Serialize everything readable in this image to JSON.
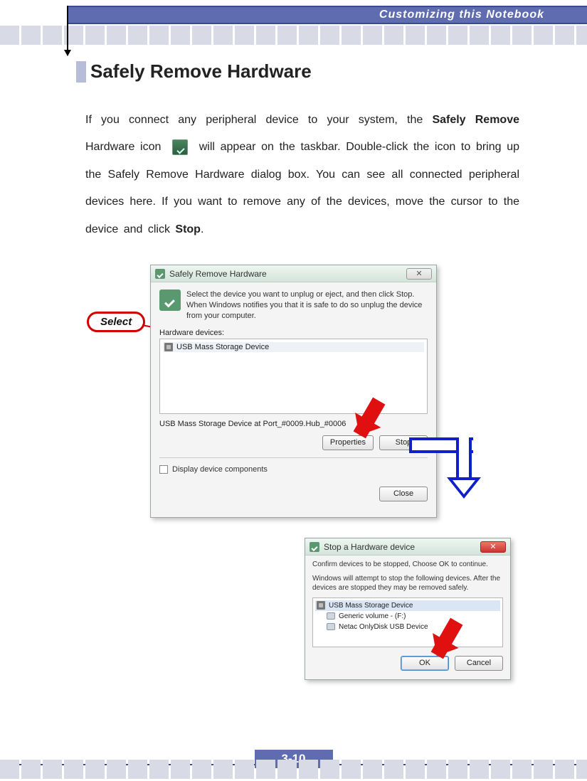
{
  "header": {
    "title": "Customizing this Notebook"
  },
  "section": {
    "title": "Safely Remove Hardware"
  },
  "paragraph": {
    "p1a": "If you connect any peripheral device to your system, the ",
    "p1b": "Safely Remove",
    "p1c": " Hardware icon ",
    "p1d": " will appear on the taskbar.  Double-click the icon to bring up the Safely Remove Hardware dialog box.  You can see all connected peripheral devices here.  If you want to remove any of the devices, move the cursor to the device and click ",
    "p1e": "Stop",
    "p1f": "."
  },
  "callout": {
    "select": "Select"
  },
  "dialog1": {
    "title": "Safely Remove Hardware",
    "instr": "Select the device you want to unplug or eject, and then click Stop. When Windows notifies you that it is safe to do so unplug the device from your computer.",
    "devices_label": "Hardware devices:",
    "device_item": "USB Mass Storage Device",
    "status": "USB Mass Storage Device at Port_#0009.Hub_#0006",
    "btn_properties": "Properties",
    "btn_stop": "Stop",
    "chk_label": "Display device components",
    "btn_close": "Close"
  },
  "dialog2": {
    "title": "Stop a Hardware device",
    "line1": "Confirm devices to be stopped, Choose OK to continue.",
    "line2": "Windows will attempt to stop the following devices. After the devices are stopped they may be removed safely.",
    "item1": "USB Mass Storage Device",
    "item2": "Generic volume - (F:)",
    "item3": "Netac OnlyDisk USB Device",
    "btn_ok": "OK",
    "btn_cancel": "Cancel"
  },
  "footer": {
    "page": "3-10"
  }
}
